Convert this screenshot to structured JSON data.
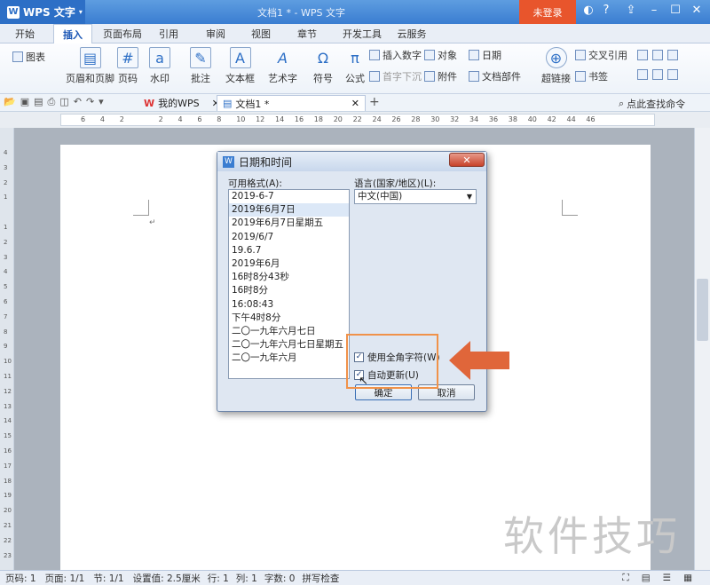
{
  "titlebar": {
    "app_name": "WPS 文字",
    "title": "文档1 * - WPS 文字",
    "login": "未登录",
    "help": "?"
  },
  "tabs": [
    "开始",
    "插入",
    "页面布局",
    "引用",
    "审阅",
    "视图",
    "章节",
    "开发工具",
    "云服务"
  ],
  "ribbon": {
    "chart": "图表",
    "header_footer": "页眉和页脚",
    "page_number": "页码",
    "watermark": "水印",
    "comment": "批注",
    "textbox": "文本框",
    "wordart": "艺术字",
    "symbol": "符号",
    "formula": "公式",
    "insert_number": "插入数字",
    "dropcap": "首字下沉",
    "object": "对象",
    "attachment": "附件",
    "date": "日期",
    "doc_parts": "文档部件",
    "hyperlink": "超链接",
    "cross_ref": "交叉引用",
    "bookmark": "书签"
  },
  "doctabs": {
    "my_wps": "我的WPS",
    "doc": "文档1 *",
    "search_cmd": "点此查找命令"
  },
  "ruler_ticks": [
    "6",
    "4",
    "2",
    "",
    "2",
    "4",
    "6",
    "8",
    "10",
    "12",
    "14",
    "16",
    "18",
    "20",
    "22",
    "24",
    "26",
    "28",
    "30",
    "32",
    "34",
    "36",
    "38",
    "40",
    "42",
    "44",
    "46"
  ],
  "left_ruler_ticks": [
    "4",
    "3",
    "2",
    "1",
    "",
    "1",
    "2",
    "3",
    "4",
    "5",
    "6",
    "7",
    "8",
    "9",
    "10",
    "11",
    "12",
    "13",
    "14",
    "15",
    "16",
    "17",
    "18",
    "19",
    "20",
    "21",
    "22",
    "23"
  ],
  "dialog": {
    "title": "日期和时间",
    "formats_label": "可用格式(A):",
    "formats": [
      "2019-6-7",
      "2019年6月7日",
      "2019年6月7日星期五",
      "2019/6/7",
      "19.6.7",
      "2019年6月",
      "16时8分43秒",
      "16时8分",
      "16:08:43",
      "下午4时8分",
      "二〇一九年六月七日",
      "二〇一九年六月七日星期五",
      "二〇一九年六月"
    ],
    "selected_index": 1,
    "language_label": "语言(国家/地区)(L):",
    "language_value": "中文(中国)",
    "fullwidth_label": "使用全角字符(W)",
    "autoupdate_label": "自动更新(U)",
    "ok": "确定",
    "cancel": "取消"
  },
  "status": {
    "page_code": "页码: 1",
    "pages": "页面: 1/1",
    "section": "节: 1/1",
    "setting": "设置值: 2.5厘米",
    "row": "行: 1",
    "col": "列: 1",
    "words": "字数: 0",
    "spell": "拼写检查"
  },
  "watermark_text": "软件技巧",
  "colors": {
    "accent": "#3a7dd1",
    "login": "#e8552c",
    "highlight": "#f0924a",
    "arrow": "#e0663a"
  }
}
